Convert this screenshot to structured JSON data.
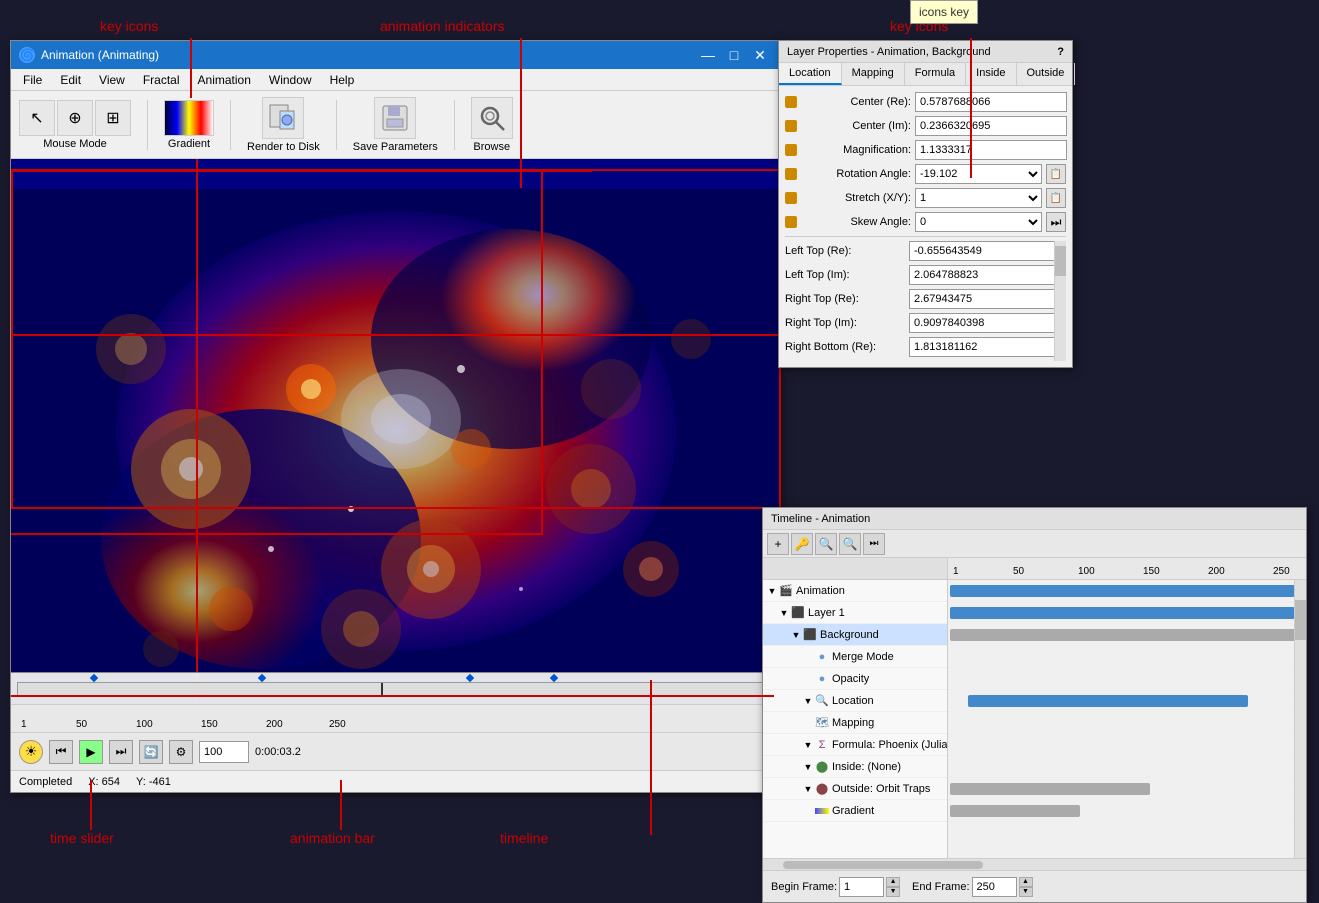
{
  "app": {
    "title": "Animation (Animating)",
    "title_icon": "🌀"
  },
  "menu": {
    "items": [
      "File",
      "Edit",
      "View",
      "Fractal",
      "Animation",
      "Window",
      "Help"
    ]
  },
  "toolbar": {
    "mouse_mode_label": "Mouse Mode",
    "gradient_label": "Gradient",
    "render_label": "Render to Disk",
    "save_label": "Save Parameters",
    "browse_label": "Browse"
  },
  "annotations": {
    "key_icons_left": "key icons",
    "animation_indicators": "animation indicators",
    "key_icons_right": "key icons",
    "time_slider": "time slider",
    "animation_bar": "animation bar",
    "timeline_label": "timeline",
    "icons_key": "icons key"
  },
  "layer_properties": {
    "title": "Layer Properties - Animation, Background",
    "tabs": [
      "Location",
      "Mapping",
      "Formula",
      "Inside",
      "Outside"
    ],
    "active_tab": "Location",
    "fields": {
      "center_re": "0.5787688066",
      "center_im": "0.2366320695",
      "magnification": "1.1333317",
      "rotation_angle": "-19.102",
      "stretch_xy": "1",
      "skew_angle": "0",
      "left_top_re": "-0.655643549",
      "left_top_im": "2.064788823",
      "right_top_re": "2.67943475",
      "right_top_im": "0.9097840398",
      "right_bottom_re": "1.813181162"
    },
    "labels": {
      "center_re": "Center (Re):",
      "center_im": "Center (Im):",
      "magnification": "Magnification:",
      "rotation_angle": "Rotation Angle:",
      "stretch_xy": "Stretch (X/Y):",
      "skew_angle": "Skew Angle:",
      "left_top_re": "Left Top (Re):",
      "left_top_im": "Left Top (Im):",
      "right_top_re": "Right Top (Re):",
      "right_top_im": "Right Top (Im):",
      "right_bottom_re": "Right Bottom (Re):"
    }
  },
  "timeline": {
    "title": "Timeline - Animation",
    "ruler_marks": [
      1,
      50,
      100,
      150,
      200,
      250
    ],
    "layers": [
      {
        "name": "Animation",
        "indent": 0,
        "icon": "anim",
        "expand": true
      },
      {
        "name": "Layer 1",
        "indent": 1,
        "icon": "layer",
        "expand": true
      },
      {
        "name": "Background",
        "indent": 2,
        "icon": "layer",
        "expand": true
      },
      {
        "name": "Merge Mode",
        "indent": 3,
        "icon": "dot",
        "expand": false
      },
      {
        "name": "Opacity",
        "indent": 3,
        "icon": "dot",
        "expand": false
      },
      {
        "name": "Location",
        "indent": 3,
        "icon": "search",
        "expand": true
      },
      {
        "name": "Mapping",
        "indent": 3,
        "icon": "map",
        "expand": false
      },
      {
        "name": "Formula: Phoenix (Julia)",
        "indent": 3,
        "icon": "formula",
        "expand": true
      },
      {
        "name": "Inside: (None)",
        "indent": 3,
        "icon": "inside",
        "expand": true
      },
      {
        "name": "Outside: Orbit Traps",
        "indent": 3,
        "icon": "outside",
        "expand": false
      },
      {
        "name": "Gradient",
        "indent": 3,
        "icon": "gradient",
        "expand": false
      }
    ],
    "begin_frame": "1",
    "end_frame": "250",
    "begin_label": "Begin Frame:",
    "end_label": "End Frame:"
  },
  "playback": {
    "frame_value": "100",
    "time_value": "0:00:03.2",
    "buttons": [
      "⏮",
      "⏭",
      "▶",
      "⏭",
      "🔄",
      "⚙"
    ]
  },
  "status": {
    "completed": "Completed",
    "x_coord": "X: 654",
    "y_coord": "Y: -461"
  },
  "window_controls": {
    "minimize": "—",
    "maximize": "□",
    "close": "✕"
  }
}
